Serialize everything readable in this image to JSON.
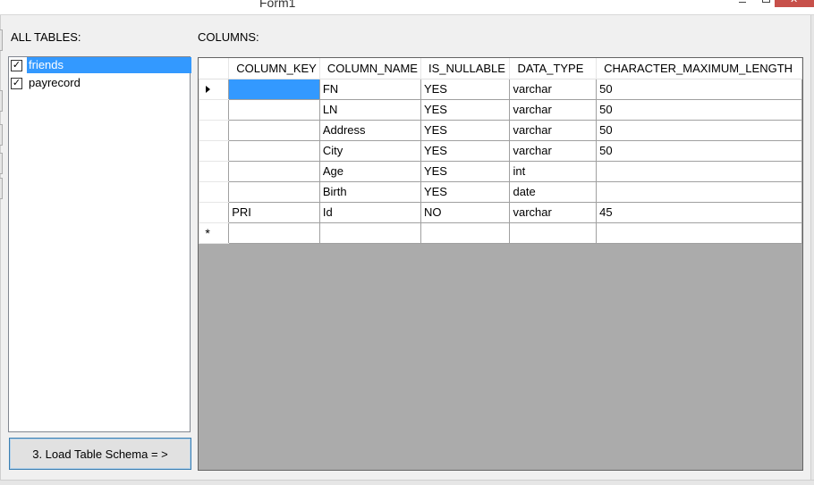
{
  "window": {
    "title": "Form1"
  },
  "labels": {
    "all_tables": "ALL TABLES:",
    "columns": "COLUMNS:"
  },
  "tables": [
    {
      "name": "friends",
      "checked": true,
      "selected": true
    },
    {
      "name": "payrecord",
      "checked": true,
      "selected": false
    }
  ],
  "load_button": {
    "label": "3. Load Table Schema = >"
  },
  "grid": {
    "headers": [
      "COLUMN_KEY",
      "COLUMN_NAME",
      "IS_NULLABLE",
      "DATA_TYPE",
      "CHARACTER_MAXIMUM_LENGTH"
    ],
    "rows": [
      {
        "key": "",
        "name": "FN",
        "nullable": "YES",
        "type": "varchar",
        "length": "50"
      },
      {
        "key": "",
        "name": "LN",
        "nullable": "YES",
        "type": "varchar",
        "length": "50"
      },
      {
        "key": "",
        "name": "Address",
        "nullable": "YES",
        "type": "varchar",
        "length": "50"
      },
      {
        "key": "",
        "name": "City",
        "nullable": "YES",
        "type": "varchar",
        "length": "50"
      },
      {
        "key": "",
        "name": "Age",
        "nullable": "YES",
        "type": "int",
        "length": ""
      },
      {
        "key": "",
        "name": "Birth",
        "nullable": "YES",
        "type": "date",
        "length": ""
      },
      {
        "key": "PRI",
        "name": "Id",
        "nullable": "NO",
        "type": "varchar",
        "length": "45"
      }
    ],
    "new_row_marker": "*"
  }
}
